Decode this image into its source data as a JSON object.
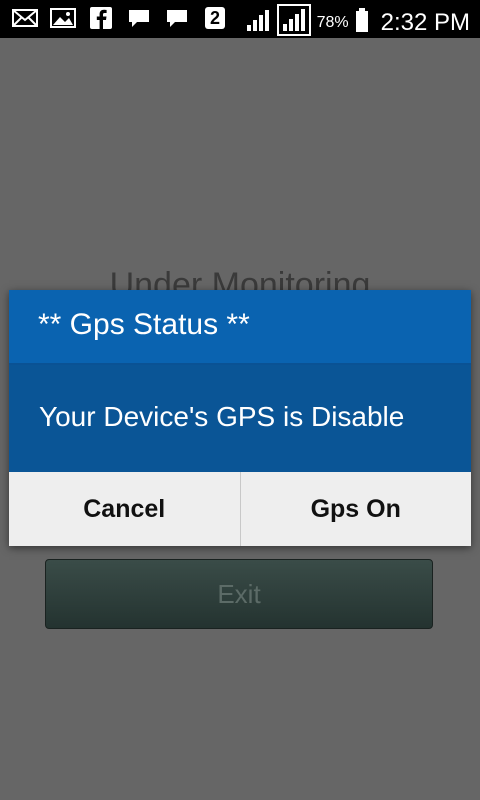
{
  "status_bar": {
    "left_icons": [
      "mail-icon",
      "image-icon",
      "facebook-icon",
      "chat-icon",
      "message-icon",
      "sim2-icon"
    ],
    "sim_badge": "2",
    "battery_percent": "78%",
    "time": "2:32 PM"
  },
  "background": {
    "title": "Under Monitoring",
    "exit_label": "Exit"
  },
  "dialog": {
    "title": "** Gps Status **",
    "message": "Your Device's GPS is Disable",
    "negative_label": "Cancel",
    "positive_label": "Gps On"
  },
  "colors": {
    "dialog_header": "#0a63b0",
    "dialog_body": "#0a5596",
    "overlay": "#666666"
  }
}
